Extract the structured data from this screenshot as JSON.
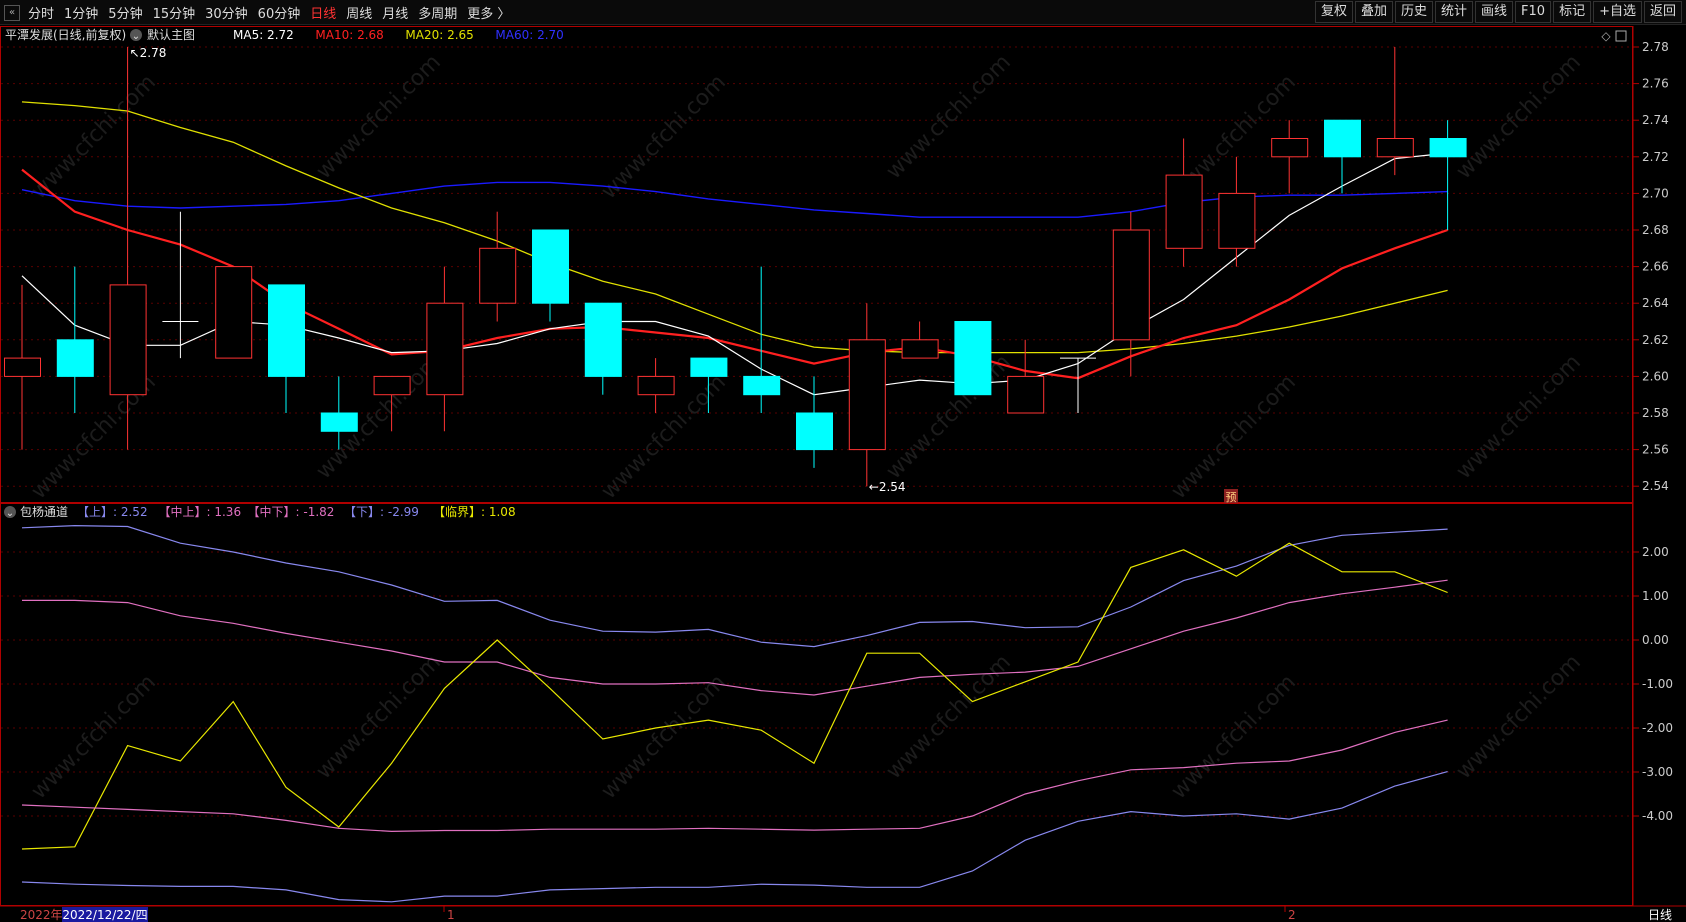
{
  "toolbar": {
    "periods": [
      "分时",
      "1分钟",
      "5分钟",
      "15分钟",
      "30分钟",
      "60分钟",
      "日线",
      "周线",
      "月线",
      "多周期",
      "更多 〉"
    ],
    "active_period": "日线",
    "tools": [
      "复权",
      "叠加",
      "历史",
      "统计",
      "画线",
      "F10",
      "标记",
      "+自选",
      "返回"
    ]
  },
  "colors": {
    "up": "#ff3333",
    "down": "#00ffff",
    "ma5": "#ffffff",
    "ma10": "#ff2020",
    "ma20": "#e0e000",
    "ma60": "#1a1aff",
    "grid": "#5a0000",
    "axis": "#b00000",
    "upper": "#8888ee",
    "midupper": "#e070c0",
    "critical": "#e8e800"
  },
  "chart_data": [
    {
      "type": "candlestick",
      "title": "平潭发展(日线,前复权)",
      "main_label": "默认主图",
      "legend": [
        {
          "label": "MA5: 2.72",
          "color": "#ffffff"
        },
        {
          "label": "MA10: 2.68",
          "color": "#ff2020"
        },
        {
          "label": "MA20: 2.65",
          "color": "#e0e000"
        },
        {
          "label": "MA60: 2.70",
          "color": "#3030ff"
        }
      ],
      "ylim": [
        2.53,
        2.79
      ],
      "y_ticks": [
        "2.78",
        "2.76",
        "2.74",
        "2.72",
        "2.70",
        "2.68",
        "2.66",
        "2.64",
        "2.62",
        "2.60",
        "2.58",
        "2.56",
        "2.54"
      ],
      "max_label": "2.78",
      "min_label": "←2.54",
      "forecast_mark": "预",
      "candles": [
        {
          "o": 2.6,
          "h": 2.65,
          "l": 2.56,
          "c": 2.61
        },
        {
          "o": 2.62,
          "h": 2.66,
          "l": 2.58,
          "c": 2.6
        },
        {
          "o": 2.59,
          "h": 2.78,
          "l": 2.56,
          "c": 2.65
        },
        {
          "o": 2.63,
          "h": 2.69,
          "l": 2.61,
          "c": 2.63
        },
        {
          "o": 2.61,
          "h": 2.66,
          "l": 2.61,
          "c": 2.66
        },
        {
          "o": 2.65,
          "h": 2.65,
          "l": 2.58,
          "c": 2.6
        },
        {
          "o": 2.58,
          "h": 2.6,
          "l": 2.56,
          "c": 2.57
        },
        {
          "o": 2.59,
          "h": 2.6,
          "l": 2.57,
          "c": 2.6
        },
        {
          "o": 2.59,
          "h": 2.66,
          "l": 2.57,
          "c": 2.64
        },
        {
          "o": 2.64,
          "h": 2.69,
          "l": 2.63,
          "c": 2.67
        },
        {
          "o": 2.68,
          "h": 2.68,
          "l": 2.63,
          "c": 2.64
        },
        {
          "o": 2.64,
          "h": 2.64,
          "l": 2.59,
          "c": 2.6
        },
        {
          "o": 2.59,
          "h": 2.61,
          "l": 2.58,
          "c": 2.6
        },
        {
          "o": 2.61,
          "h": 2.61,
          "l": 2.58,
          "c": 2.6
        },
        {
          "o": 2.6,
          "h": 2.66,
          "l": 2.58,
          "c": 2.59
        },
        {
          "o": 2.58,
          "h": 2.6,
          "l": 2.55,
          "c": 2.56
        },
        {
          "o": 2.56,
          "h": 2.64,
          "l": 2.54,
          "c": 2.62
        },
        {
          "o": 2.61,
          "h": 2.63,
          "l": 2.61,
          "c": 2.62
        },
        {
          "o": 2.63,
          "h": 2.63,
          "l": 2.59,
          "c": 2.59
        },
        {
          "o": 2.58,
          "h": 2.62,
          "l": 2.58,
          "c": 2.6
        },
        {
          "o": 2.61,
          "h": 2.61,
          "l": 2.58,
          "c": 2.61
        },
        {
          "o": 2.62,
          "h": 2.69,
          "l": 2.6,
          "c": 2.68
        },
        {
          "o": 2.67,
          "h": 2.73,
          "l": 2.66,
          "c": 2.71
        },
        {
          "o": 2.67,
          "h": 2.72,
          "l": 2.66,
          "c": 2.7
        },
        {
          "o": 2.72,
          "h": 2.74,
          "l": 2.7,
          "c": 2.73
        },
        {
          "o": 2.74,
          "h": 2.74,
          "l": 2.7,
          "c": 2.72
        },
        {
          "o": 2.72,
          "h": 2.78,
          "l": 2.71,
          "c": 2.73
        },
        {
          "o": 2.73,
          "h": 2.74,
          "l": 2.68,
          "c": 2.72
        }
      ],
      "ma5": [
        2.655,
        2.628,
        2.617,
        2.617,
        2.63,
        2.628,
        2.621,
        2.613,
        2.614,
        2.618,
        2.626,
        2.63,
        2.63,
        2.622,
        2.604,
        2.59,
        2.594,
        2.598,
        2.596,
        2.598,
        2.607,
        2.626,
        2.642,
        2.665,
        2.688,
        2.704,
        2.719,
        2.722
      ],
      "ma10": [
        2.713,
        2.69,
        2.68,
        2.672,
        2.66,
        2.64,
        2.626,
        2.612,
        2.614,
        2.621,
        2.626,
        2.627,
        2.624,
        2.621,
        2.614,
        2.607,
        2.613,
        2.616,
        2.611,
        2.603,
        2.599,
        2.611,
        2.621,
        2.628,
        2.642,
        2.659,
        2.67,
        2.68
      ],
      "ma20": [
        2.75,
        2.748,
        2.745,
        2.736,
        2.728,
        2.715,
        2.703,
        2.692,
        2.684,
        2.674,
        2.662,
        2.652,
        2.645,
        2.634,
        2.623,
        2.616,
        2.614,
        2.613,
        2.613,
        2.613,
        2.613,
        2.615,
        2.618,
        2.622,
        2.627,
        2.633,
        2.64,
        2.647
      ],
      "ma60": [
        2.702,
        2.696,
        2.693,
        2.692,
        2.693,
        2.694,
        2.696,
        2.7,
        2.704,
        2.706,
        2.706,
        2.704,
        2.701,
        2.697,
        2.694,
        2.691,
        2.689,
        2.687,
        2.687,
        2.687,
        2.687,
        2.69,
        2.695,
        2.698,
        2.699,
        2.699,
        2.7,
        2.701
      ]
    },
    {
      "type": "line",
      "title": "包杨通道",
      "legend": [
        {
          "label": "【上】: 2.52",
          "color": "#8888ee"
        },
        {
          "label": "【中上】: 1.36",
          "color": "#e070c0"
        },
        {
          "label": "【中下】: -1.82",
          "color": "#e070c0"
        },
        {
          "label": "【下】: -2.99",
          "color": "#8888ee"
        },
        {
          "label": "【临界】: 1.08",
          "color": "#e8e800"
        }
      ],
      "ylim": [
        -6.0,
        3.0
      ],
      "y_ticks": [
        "2.00",
        "1.00",
        "0.00",
        "-1.00",
        "-2.00",
        "-3.00",
        "-4.00"
      ],
      "series": [
        {
          "key": "upper",
          "values": [
            2.55,
            2.6,
            2.58,
            2.2,
            2.0,
            1.75,
            1.55,
            1.25,
            0.88,
            0.9,
            0.45,
            0.2,
            0.18,
            0.24,
            -0.05,
            -0.15,
            0.1,
            0.4,
            0.42,
            0.28,
            0.3,
            0.75,
            1.35,
            1.68,
            2.15,
            2.38,
            2.45,
            2.52
          ]
        },
        {
          "key": "midupper",
          "values": [
            0.9,
            0.9,
            0.85,
            0.55,
            0.38,
            0.15,
            -0.05,
            -0.25,
            -0.5,
            -0.5,
            -0.85,
            -1.0,
            -1.0,
            -0.97,
            -1.15,
            -1.25,
            -1.05,
            -0.85,
            -0.78,
            -0.73,
            -0.6,
            -0.2,
            0.2,
            0.5,
            0.85,
            1.05,
            1.2,
            1.36
          ]
        },
        {
          "key": "critical",
          "values": [
            -4.75,
            -4.7,
            -2.4,
            -2.75,
            -1.4,
            -3.35,
            -4.25,
            -2.8,
            -1.1,
            0.0,
            -1.1,
            -2.25,
            -2.0,
            -1.82,
            -2.05,
            -2.8,
            -0.3,
            -0.3,
            -1.4,
            -0.95,
            -0.5,
            1.65,
            2.05,
            1.45,
            2.2,
            1.55,
            1.55,
            1.08
          ]
        },
        {
          "key": "midlower",
          "values": [
            -3.75,
            -3.8,
            -3.85,
            -3.9,
            -3.95,
            -4.1,
            -4.28,
            -4.35,
            -4.33,
            -4.33,
            -4.3,
            -4.3,
            -4.3,
            -4.28,
            -4.3,
            -4.32,
            -4.3,
            -4.28,
            -4.0,
            -3.5,
            -3.2,
            -2.95,
            -2.9,
            -2.8,
            -2.75,
            -2.5,
            -2.1,
            -1.82
          ]
        },
        {
          "key": "lower",
          "values": [
            -5.5,
            -5.55,
            -5.58,
            -5.6,
            -5.6,
            -5.68,
            -5.9,
            -5.95,
            -5.82,
            -5.82,
            -5.68,
            -5.65,
            -5.62,
            -5.62,
            -5.55,
            -5.57,
            -5.62,
            -5.62,
            -5.25,
            -4.55,
            -4.12,
            -3.9,
            -4.0,
            -3.95,
            -4.07,
            -3.82,
            -3.32,
            -2.99
          ]
        }
      ]
    }
  ],
  "x_axis": {
    "labels": [
      "2022年",
      "1",
      "2"
    ],
    "date_box": "2022/12/22/四",
    "period_box": "日线"
  }
}
